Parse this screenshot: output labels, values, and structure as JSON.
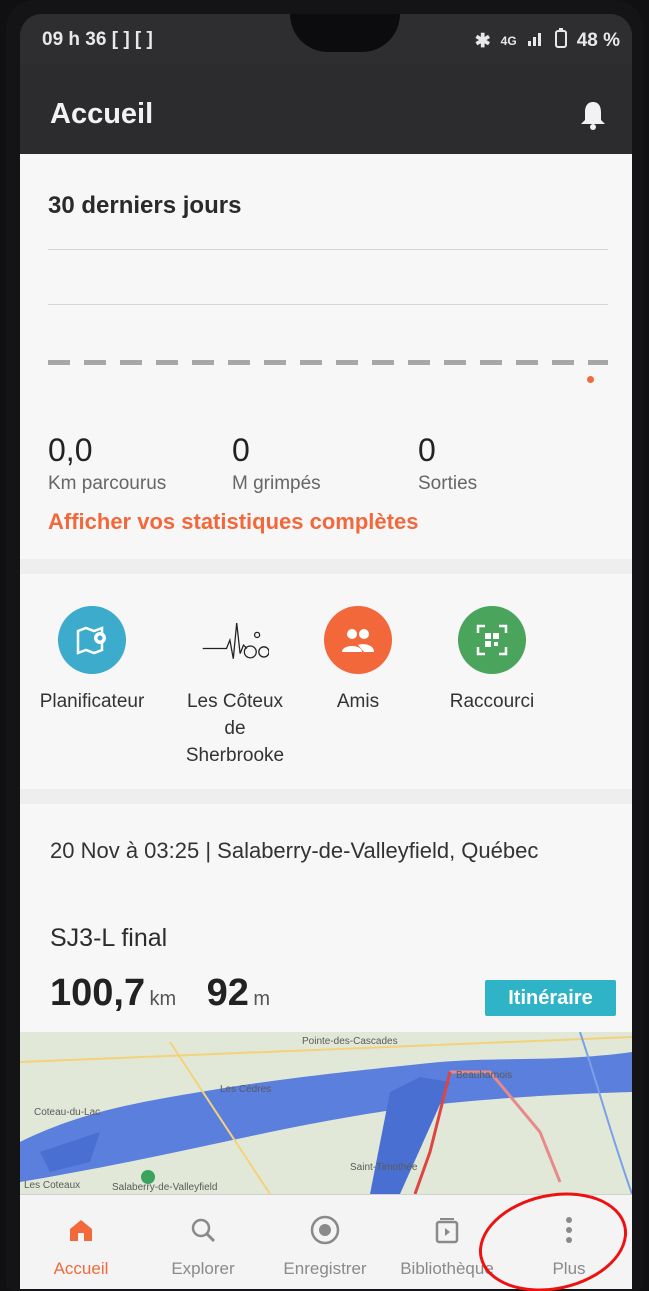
{
  "status_bar": {
    "time": "09 h 36 [ ] [ ]",
    "signal": "4G",
    "battery": "48 %"
  },
  "app_bar": {
    "title": "Accueil"
  },
  "stats": {
    "title": "30 derniers jours",
    "km_value": "0,0",
    "km_label": "Km parcourus",
    "climb_value": "0",
    "climb_label": "M grimpés",
    "rides_value": "0",
    "rides_label": "Sorties",
    "link": "Afficher vos statistiques complètes"
  },
  "shortcuts": [
    {
      "label": "Planificateur",
      "icon": "map-pin-icon",
      "color": "#3cabcc"
    },
    {
      "label": "Les Côteux de Sherbrooke",
      "icon": "cyclist-heartbeat-logo",
      "color": "#f7f7f7"
    },
    {
      "label": "Amis",
      "icon": "friends-icon",
      "color": "#f2683a"
    },
    {
      "label": "Raccourci",
      "icon": "qr-code-icon",
      "color": "#4aa45c"
    }
  ],
  "activity": {
    "meta": "20 Nov à 03:25  |  Salaberry-de-Valleyfield, Québec",
    "name": "SJ3-L final",
    "distance_value": "100,7",
    "distance_unit": "km",
    "elevation_value": "92",
    "elevation_unit": "m",
    "route_button": "Itinéraire",
    "map_labels": [
      "Pointe-des-Cascades",
      "Les Cèdres",
      "Coteau-du-Lac",
      "Beauharnois",
      "Saint-Timothée",
      "Les Coteaux",
      "Salaberry-de-Valleyfield"
    ]
  },
  "bottom_nav": [
    {
      "label": "Accueil",
      "icon": "home-icon",
      "active": true
    },
    {
      "label": "Explorer",
      "icon": "search-icon",
      "active": false
    },
    {
      "label": "Enregistrer",
      "icon": "record-icon",
      "active": false
    },
    {
      "label": "Bibliothèque",
      "icon": "library-icon",
      "active": false
    },
    {
      "label": "Plus",
      "icon": "more-vertical-icon",
      "active": false
    }
  ],
  "colors": {
    "accent": "#f26a3c",
    "route_button": "#2fb3c6",
    "annotation": "#e11111"
  }
}
